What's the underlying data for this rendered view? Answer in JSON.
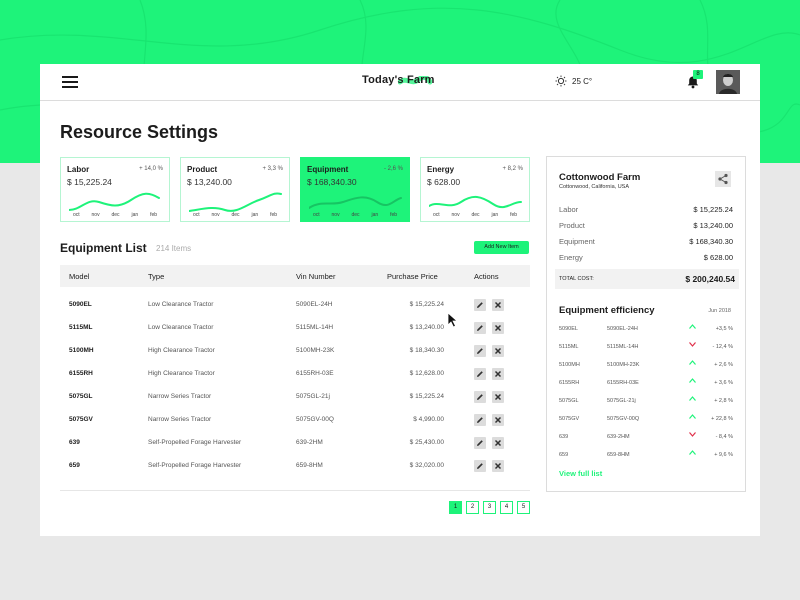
{
  "colors": {
    "accent": "#1ef37a",
    "up": "#1ef37a",
    "down": "#e0304a"
  },
  "header": {
    "brand": "Today's Farm",
    "temperature": "25 C°",
    "notifications": "8",
    "icons": [
      "menu-icon",
      "sun-icon",
      "bell-icon",
      "avatar"
    ]
  },
  "page": {
    "title": "Resource Settings"
  },
  "stats": [
    {
      "name": "Labor",
      "change": "+ 14,0 %",
      "value": "$ 15,225.24",
      "ticks": [
        "oct",
        "nov",
        "dec",
        "jan",
        "feb"
      ],
      "active": false
    },
    {
      "name": "Product",
      "change": "+ 3,3 %",
      "value": "$ 13,240.00",
      "ticks": [
        "oct",
        "nov",
        "dec",
        "jan",
        "feb"
      ],
      "active": false
    },
    {
      "name": "Equipment",
      "change": "- 2,6 %",
      "value": "$ 168,340.30",
      "ticks": [
        "oct",
        "nov",
        "dec",
        "jan",
        "feb"
      ],
      "active": true
    },
    {
      "name": "Energy",
      "change": "+ 8,2 %",
      "value": "$ 628.00",
      "ticks": [
        "oct",
        "nov",
        "dec",
        "jan",
        "feb"
      ],
      "active": false
    }
  ],
  "equipment": {
    "title": "Equipment List",
    "count": "214 Items",
    "add_label": "Add New Item",
    "columns": [
      "Model",
      "Type",
      "Vin Number",
      "Purchase Price",
      "Actions"
    ],
    "rows": [
      {
        "model": "5090EL",
        "type": "Low Clearance Tractor",
        "vin": "5090EL-24H",
        "price": "$ 15,225.24"
      },
      {
        "model": "5115ML",
        "type": "Low Clearance Tractor",
        "vin": "5115ML-14H",
        "price": "$ 13,240.00"
      },
      {
        "model": "5100MH",
        "type": "High Clearance Tractor",
        "vin": "5100MH-23K",
        "price": "$ 18,340.30"
      },
      {
        "model": "6155RH",
        "type": "High Clearance Tractor",
        "vin": "6155RH-03E",
        "price": "$ 12,628.00"
      },
      {
        "model": "5075GL",
        "type": "Narrow Series Tractor",
        "vin": "5075GL-21j",
        "price": "$ 15,225.24"
      },
      {
        "model": "5075GV",
        "type": "Narrow Series Tractor",
        "vin": "5075GV-00Q",
        "price": "$ 4,990.00"
      },
      {
        "model": "639",
        "type": "Self-Propelled Forage Harvester",
        "vin": "639-2HM",
        "price": "$ 25,430.00"
      },
      {
        "model": "659",
        "type": "Self-Propelled Forage Harvester",
        "vin": "659-8HM",
        "price": "$ 32,020.00"
      }
    ],
    "pages": [
      "1",
      "2",
      "3",
      "4",
      "5"
    ],
    "active_page": "1"
  },
  "farm": {
    "name": "Cottonwood Farm",
    "location": "Cottonwood, California, USA",
    "costs": [
      {
        "label": "Labor",
        "amount": "$ 15,225.24"
      },
      {
        "label": "Product",
        "amount": "$ 13,240.00"
      },
      {
        "label": "Equipment",
        "amount": "$ 168,340.30"
      },
      {
        "label": "Energy",
        "amount": "$ 628.00"
      }
    ],
    "total_label": "TOTAL COST:",
    "total_amount": "$ 200,240.54",
    "efficiency_title": "Equipment efficiency",
    "efficiency_date": "Jun 2018",
    "efficiency": [
      {
        "model": "5090EL",
        "vin": "5090EL-24H",
        "trend": "up",
        "pct": "+3,5 %"
      },
      {
        "model": "5115ML",
        "vin": "5115ML-14H",
        "trend": "down",
        "pct": "- 12,4 %"
      },
      {
        "model": "5100MH",
        "vin": "5100MH-23K",
        "trend": "up",
        "pct": "+ 2,6 %"
      },
      {
        "model": "6155RH",
        "vin": "6155RH-03E",
        "trend": "up",
        "pct": "+ 3,6 %"
      },
      {
        "model": "5075GL",
        "vin": "5075GL-21j",
        "trend": "up",
        "pct": "+ 2,8 %"
      },
      {
        "model": "5075GV",
        "vin": "5075GV-00Q",
        "trend": "up",
        "pct": "+ 22,8 %"
      },
      {
        "model": "639",
        "vin": "639-2HM",
        "trend": "down",
        "pct": "- 8,4 %"
      },
      {
        "model": "659",
        "vin": "659-8HM",
        "trend": "up",
        "pct": "+ 9,6 %"
      }
    ],
    "view_full": "View full list"
  }
}
